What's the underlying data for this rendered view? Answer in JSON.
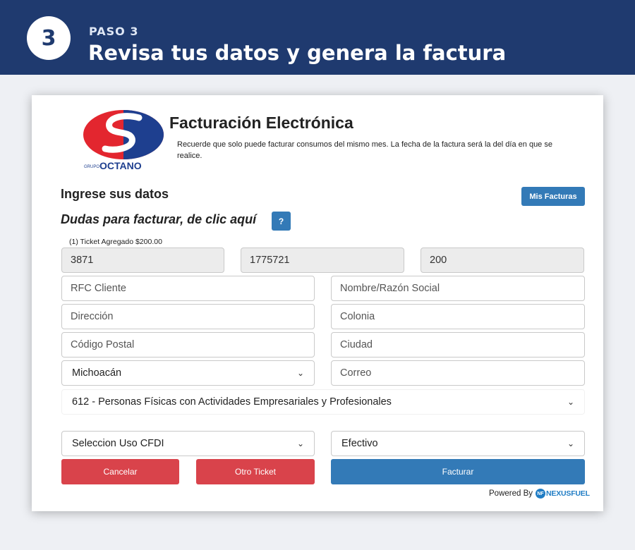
{
  "banner": {
    "step_number": "3",
    "step_label": "PASO 3",
    "title": "Revisa tus datos y genera la factura"
  },
  "header": {
    "logo_group": "GRUPO",
    "logo_name": "OCTANO",
    "app_title": "Facturación Electrónica",
    "notice": "Recuerde que solo puede facturar consumos del mismo mes. La fecha de la factura será la del día en que se realice."
  },
  "form": {
    "section_title": "Ingrese sus datos",
    "mis_facturas_label": "Mis Facturas",
    "help_text": "Dudas para facturar, de clic aquí",
    "help_button": "?",
    "ticket_note": "(1) Ticket Agregado $200.00",
    "ticket_values": [
      "3871",
      "1775721",
      "200"
    ],
    "placeholders": {
      "rfc": "RFC Cliente",
      "nombre": "Nombre/Razón Social",
      "direccion": "Dirección",
      "colonia": "Colonia",
      "codigo_postal": "Código Postal",
      "ciudad": "Ciudad",
      "correo": "Correo"
    },
    "estado_selected": "Michoacán",
    "regimen_selected": "612 - Personas Físicas con Actividades Empresariales y Profesionales",
    "uso_cfdi_selected": "Seleccion Uso CFDI",
    "forma_pago_selected": "Efectivo",
    "cancelar_label": "Cancelar",
    "otro_ticket_label": "Otro Ticket",
    "facturar_label": "Facturar"
  },
  "footer": {
    "powered_by": "Powered By",
    "brand_badge": "NF",
    "brand_name": "NEXUSFUEL"
  },
  "colors": {
    "banner": "#1f3a6f",
    "primary": "#337ab7",
    "danger": "#d9434b",
    "logo_red": "#e3262f",
    "logo_blue": "#1e3f8f"
  },
  "icons": {
    "select_chevron": "chevron-down-icon",
    "logo": "octano-logo",
    "brand": "nexusfuel-logo"
  }
}
